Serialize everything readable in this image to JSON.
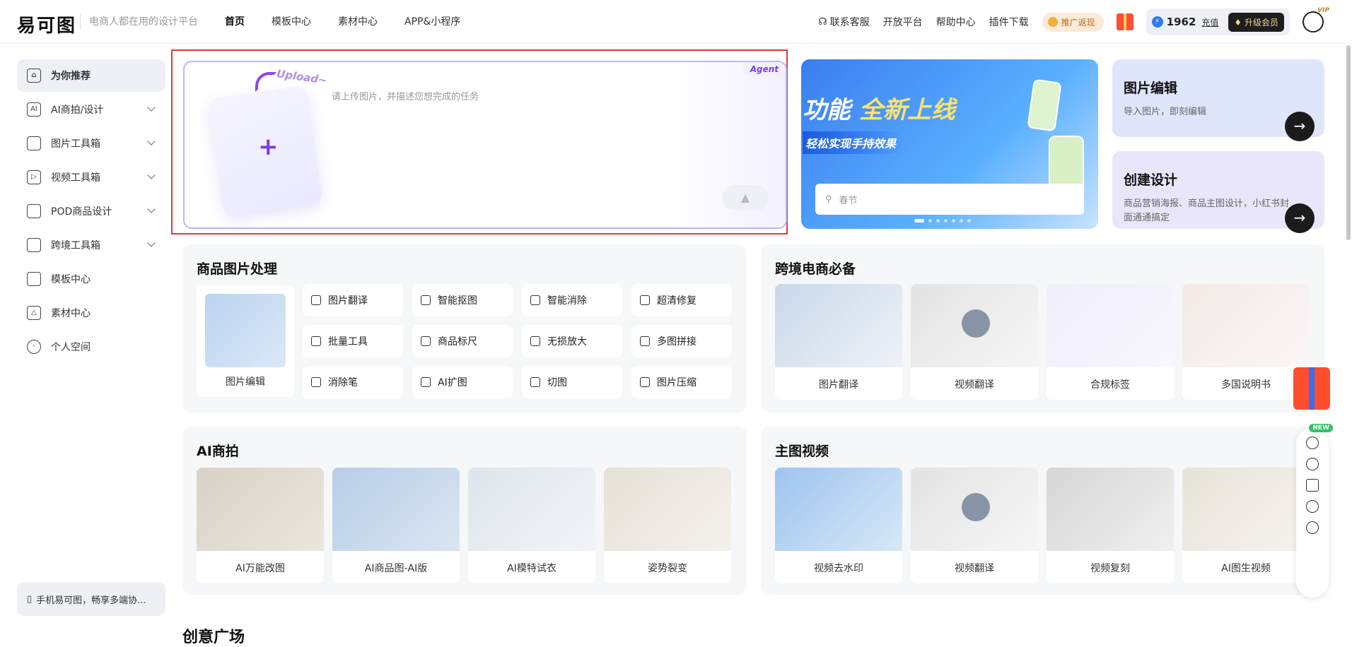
{
  "header": {
    "logo": "易可图",
    "slogan": "电商人都在用的设计平台",
    "nav": [
      "首页",
      "模板中心",
      "素材中心",
      "APP&小程序"
    ],
    "links": [
      "联系客服",
      "开放平台",
      "帮助中心",
      "插件下载"
    ],
    "promo": "推广返现",
    "credits": "1962",
    "recharge": "充值",
    "upgrade": "升级会员",
    "vip_badge": "VIP"
  },
  "sidebar": {
    "items": [
      {
        "label": "为你推荐",
        "icon": "home-icon"
      },
      {
        "label": "AI商拍/设计",
        "icon": "ai-icon"
      },
      {
        "label": "图片工具箱",
        "icon": "toolbox-icon"
      },
      {
        "label": "视频工具箱",
        "icon": "video-icon"
      },
      {
        "label": "POD商品设计",
        "icon": "pod-icon"
      },
      {
        "label": "跨境工具箱",
        "icon": "crossborder-icon"
      },
      {
        "label": "模板中心",
        "icon": "template-icon"
      },
      {
        "label": "素材中心",
        "icon": "material-icon"
      },
      {
        "label": "个人空间",
        "icon": "user-icon"
      }
    ],
    "mobile": "手机易可图，畅享多端协..."
  },
  "upload": {
    "agent": "Agent",
    "upload_word": "Upload~",
    "placeholder": "请上传图片，并描述您想完成的任务"
  },
  "banner": {
    "line1_prefix": "功能",
    "line1_highlight": "全新上线",
    "line2": "轻松实现手持效果",
    "search_placeholder": "春节"
  },
  "quick_cards": [
    {
      "title": "图片编辑",
      "desc": "导入图片，即刻编辑"
    },
    {
      "title": "创建设计",
      "desc": "商品营销海报、商品主图设计，小红书封面通通搞定"
    }
  ],
  "product_image": {
    "title": "商品图片处理",
    "main_label": "图片编辑",
    "tools": [
      "图片翻译",
      "智能抠图",
      "智能消除",
      "超清修复",
      "批量工具",
      "商品标尺",
      "无损放大",
      "多图拼接",
      "消除笔",
      "AI扩图",
      "切图",
      "图片压缩"
    ]
  },
  "crossborder": {
    "title": "跨境电商必备",
    "items": [
      "图片翻译",
      "视频翻译",
      "合规标签",
      "多国说明书"
    ]
  },
  "ai_shoot": {
    "title": "AI商拍",
    "items": [
      "AI万能改图",
      "AI商品图-AI版",
      "AI模特试衣",
      "姿势裂变"
    ]
  },
  "main_video": {
    "title": "主图视频",
    "items": [
      "视频去水印",
      "视频翻译",
      "视频复刻",
      "AI图生视频"
    ]
  },
  "next_section": "创意广场",
  "right_tools": {
    "new_tag": "NEW"
  }
}
